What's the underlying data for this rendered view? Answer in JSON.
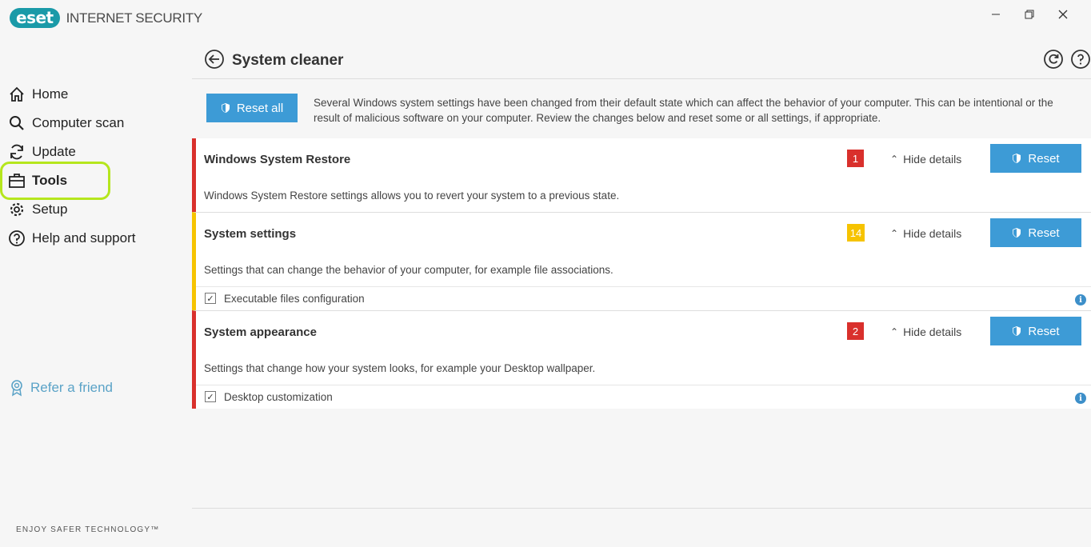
{
  "app": {
    "logo": "eset",
    "product": "INTERNET SECURITY",
    "tagline": "ENJOY SAFER TECHNOLOGY™"
  },
  "window_controls": {
    "minimize": "—",
    "maximize": "❐",
    "close": "✕"
  },
  "sidebar": {
    "items": [
      {
        "label": "Home",
        "icon": "home-icon"
      },
      {
        "label": "Computer scan",
        "icon": "search-icon"
      },
      {
        "label": "Update",
        "icon": "refresh-icon"
      },
      {
        "label": "Tools",
        "icon": "briefcase-icon",
        "active": true
      },
      {
        "label": "Setup",
        "icon": "gear-icon"
      },
      {
        "label": "Help and support",
        "icon": "help-icon"
      }
    ],
    "refer": "Refer a friend"
  },
  "page": {
    "title": "System cleaner",
    "reset_all": "Reset all",
    "intro": "Several Windows system settings have been changed from their default state which can affect the behavior of your computer. This can be intentional or the result of malicious software on your computer. Review the changes below and reset some or all settings, if appropriate."
  },
  "sections": [
    {
      "title": "Windows System Restore",
      "count": "1",
      "severity": "red",
      "hide": "Hide details",
      "reset": "Reset",
      "desc": "Windows System Restore settings allows you to revert your system to a previous state.",
      "items": []
    },
    {
      "title": "System settings",
      "count": "14",
      "severity": "yellow",
      "hide": "Hide details",
      "reset": "Reset",
      "desc": "Settings that can change the behavior of your computer, for example file associations.",
      "items": [
        {
          "label": "Executable files configuration",
          "checked": true
        }
      ]
    },
    {
      "title": "System appearance",
      "count": "2",
      "severity": "red",
      "hide": "Hide details",
      "reset": "Reset",
      "desc": "Settings that change how your system looks, for example your Desktop wallpaper.",
      "items": [
        {
          "label": "Desktop customization",
          "checked": true
        }
      ]
    }
  ],
  "colors": {
    "accent": "#3d9bd6",
    "danger": "#d9302c",
    "warning": "#f6c300",
    "brand": "#1a9aa8",
    "highlight": "#b5e61d"
  }
}
